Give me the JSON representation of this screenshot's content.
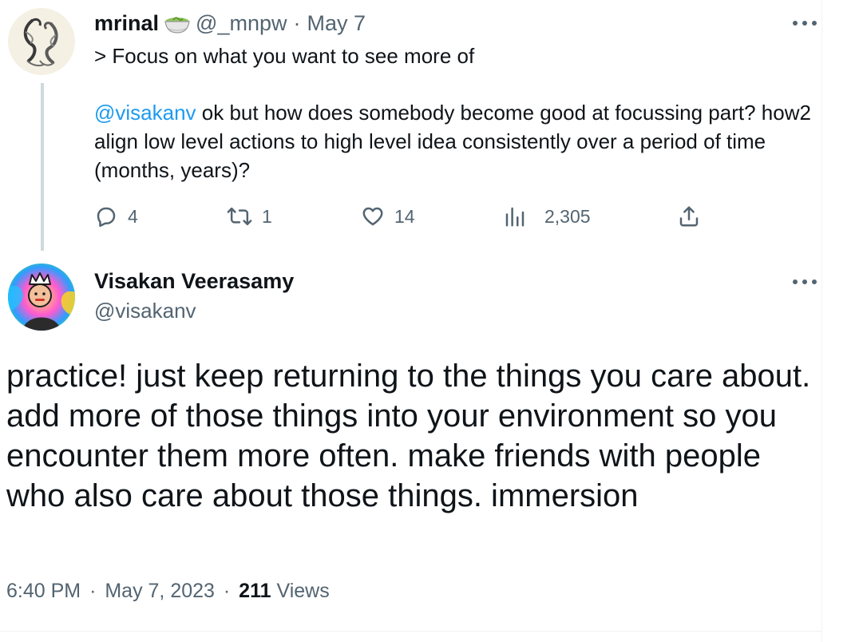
{
  "reply_tweet": {
    "author_name": "mrinal",
    "author_emoji": "matcha-bowl-icon",
    "handle": "@_mnpw",
    "separator": "·",
    "date": "May 7",
    "quote_line": "> Focus on what you want to see more of",
    "mention": "@visakanv",
    "body_rest": " ok but how does somebody become good at focussing part? how2 align low level actions to high level idea consistently over a period of time (months, years)?",
    "actions": {
      "replies": "4",
      "retweets": "1",
      "likes": "14",
      "views": "2,305"
    }
  },
  "main_tweet": {
    "author_name": "Visakan Veerasamy",
    "handle": "@visakanv",
    "text": "practice! just keep returning to the things you care about. add more of those things into your environment so you encounter them more often. make friends with people who also care about those things. immersion",
    "time": "6:40 PM",
    "separator": "·",
    "date": "May 7, 2023",
    "views_count": "211",
    "views_label": "Views"
  },
  "colors": {
    "accent": "#1d9bf0",
    "muted": "#536471",
    "text": "#0f1419",
    "thread_line": "#cfd9de"
  }
}
